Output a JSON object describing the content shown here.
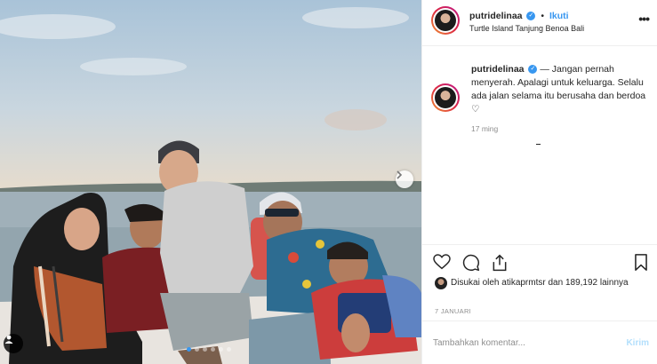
{
  "header": {
    "username": "putridelinaa",
    "separator": "•",
    "follow_label": "Ikuti",
    "location": "Turtle Island Tanjung Benoa Bali",
    "more_label": "•••"
  },
  "caption": {
    "username": "putridelinaa",
    "text": "— Jangan pernah menyerah. Apalagi untuk keluarga. Selalu ada jalan selama itu berusaha dan berdoa ♡",
    "time": "17 ming"
  },
  "likes": {
    "text": "Disukai oleh atikaprmtsr dan 189,192 lainnya"
  },
  "date": "7 JANUARI",
  "comment": {
    "placeholder": "Tambahkan komentar...",
    "post_label": "Kirim"
  },
  "carousel": {
    "total": 6,
    "active_index": 0
  },
  "colors": {
    "accent": "#3897f0",
    "post_disabled": "#b2dffc",
    "muted": "#8e8e8e"
  },
  "icons": [
    "heart-icon",
    "comment-icon",
    "share-icon",
    "bookmark-icon",
    "chevron-right-icon",
    "user-tag-icon",
    "verified-badge-icon"
  ]
}
